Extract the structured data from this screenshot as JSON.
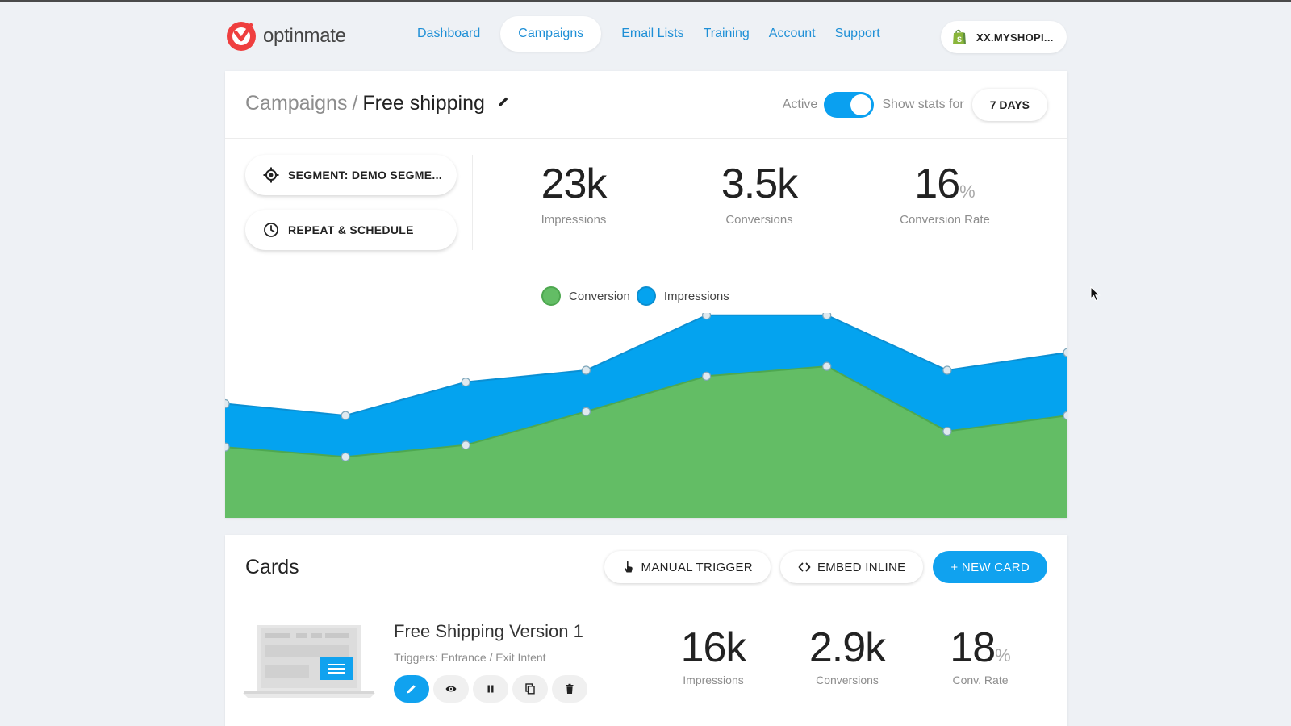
{
  "brand": {
    "name": "optinmate",
    "color": "#ef3f3f"
  },
  "nav": {
    "items": [
      "Dashboard",
      "Campaigns",
      "Email Lists",
      "Training",
      "Account",
      "Support"
    ],
    "active": "Campaigns",
    "store_label": "XX.MYSHOPI...",
    "store_icon": "shopify-bag-icon"
  },
  "campaign": {
    "breadcrumb_parent": "Campaigns",
    "breadcrumb_sep": "/",
    "title": "Free shipping",
    "active_label": "Active",
    "active": true,
    "show_stats_label": "Show stats for",
    "range_label": "7 DAYS",
    "segment_label": "SEGMENT: DEMO SEGME...",
    "schedule_label": "REPEAT & SCHEDULE",
    "stats": [
      {
        "value": "23k",
        "unit": "",
        "label": "Impressions"
      },
      {
        "value": "3.5k",
        "unit": "",
        "label": "Conversions"
      },
      {
        "value": "16",
        "unit": "%",
        "label": "Conversion Rate"
      }
    ]
  },
  "chart_data": {
    "type": "area",
    "stacked": true,
    "legend": "top-center",
    "x_labels_visible": false,
    "y_labels_visible": false,
    "colors": {
      "Conversion": "#63bd65",
      "Impressions": "#04a3ef"
    },
    "series": [
      {
        "name": "Conversion",
        "values": [
          0.36,
          0.31,
          0.37,
          0.54,
          0.72,
          0.77,
          0.44,
          0.52
        ]
      },
      {
        "name": "Impressions",
        "values": [
          0.22,
          0.21,
          0.32,
          0.21,
          0.31,
          0.26,
          0.31,
          0.32
        ]
      }
    ]
  },
  "cards": {
    "title": "Cards",
    "manual_trigger_label": "MANUAL TRIGGER",
    "embed_inline_label": "EMBED INLINE",
    "new_card_label": "+ NEW CARD",
    "items": [
      {
        "name": "Free Shipping Version 1",
        "triggers": "Triggers: Entrance / Exit Intent",
        "stats": [
          {
            "value": "16k",
            "unit": "",
            "label": "Impressions"
          },
          {
            "value": "2.9k",
            "unit": "",
            "label": "Conversions"
          },
          {
            "value": "18",
            "unit": "%",
            "label": "Conv. Rate"
          }
        ]
      }
    ]
  }
}
